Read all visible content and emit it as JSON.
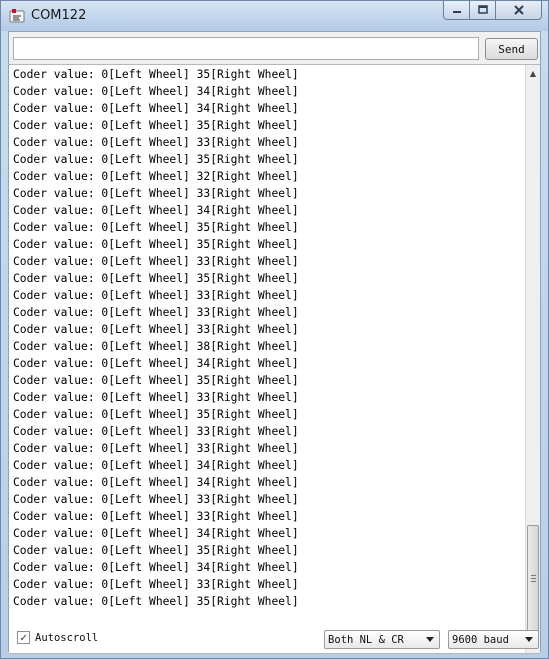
{
  "window": {
    "title": "COM122",
    "icon": "arduino-serial-icon"
  },
  "titlebar_controls": {
    "minimize_icon": "minimize-icon",
    "maximize_icon": "maximize-icon",
    "close_icon": "close-icon"
  },
  "send": {
    "input_value": "",
    "input_placeholder": "",
    "button_label": "Send"
  },
  "output": {
    "lines": [
      "Coder value: 0[Left Wheel] 35[Right Wheel]",
      "Coder value: 0[Left Wheel] 34[Right Wheel]",
      "Coder value: 0[Left Wheel] 34[Right Wheel]",
      "Coder value: 0[Left Wheel] 35[Right Wheel]",
      "Coder value: 0[Left Wheel] 33[Right Wheel]",
      "Coder value: 0[Left Wheel] 35[Right Wheel]",
      "Coder value: 0[Left Wheel] 32[Right Wheel]",
      "Coder value: 0[Left Wheel] 33[Right Wheel]",
      "Coder value: 0[Left Wheel] 34[Right Wheel]",
      "Coder value: 0[Left Wheel] 35[Right Wheel]",
      "Coder value: 0[Left Wheel] 35[Right Wheel]",
      "Coder value: 0[Left Wheel] 33[Right Wheel]",
      "Coder value: 0[Left Wheel] 35[Right Wheel]",
      "Coder value: 0[Left Wheel] 33[Right Wheel]",
      "Coder value: 0[Left Wheel] 33[Right Wheel]",
      "Coder value: 0[Left Wheel] 33[Right Wheel]",
      "Coder value: 0[Left Wheel] 38[Right Wheel]",
      "Coder value: 0[Left Wheel] 34[Right Wheel]",
      "Coder value: 0[Left Wheel] 35[Right Wheel]",
      "Coder value: 0[Left Wheel] 33[Right Wheel]",
      "Coder value: 0[Left Wheel] 35[Right Wheel]",
      "Coder value: 0[Left Wheel] 33[Right Wheel]",
      "Coder value: 0[Left Wheel] 33[Right Wheel]",
      "Coder value: 0[Left Wheel] 34[Right Wheel]",
      "Coder value: 0[Left Wheel] 34[Right Wheel]",
      "Coder value: 0[Left Wheel] 33[Right Wheel]",
      "Coder value: 0[Left Wheel] 33[Right Wheel]",
      "Coder value: 0[Left Wheel] 34[Right Wheel]",
      "Coder value: 0[Left Wheel] 35[Right Wheel]",
      "Coder value: 0[Left Wheel] 34[Right Wheel]",
      "Coder value: 0[Left Wheel] 33[Right Wheel]",
      "Coder value: 0[Left Wheel] 35[Right Wheel]"
    ]
  },
  "footer": {
    "autoscroll_label": "Autoscroll",
    "autoscroll_checked": true,
    "checkmark": "✓",
    "line_ending_selected": "Both NL & CR",
    "baud_selected": "9600 baud"
  }
}
